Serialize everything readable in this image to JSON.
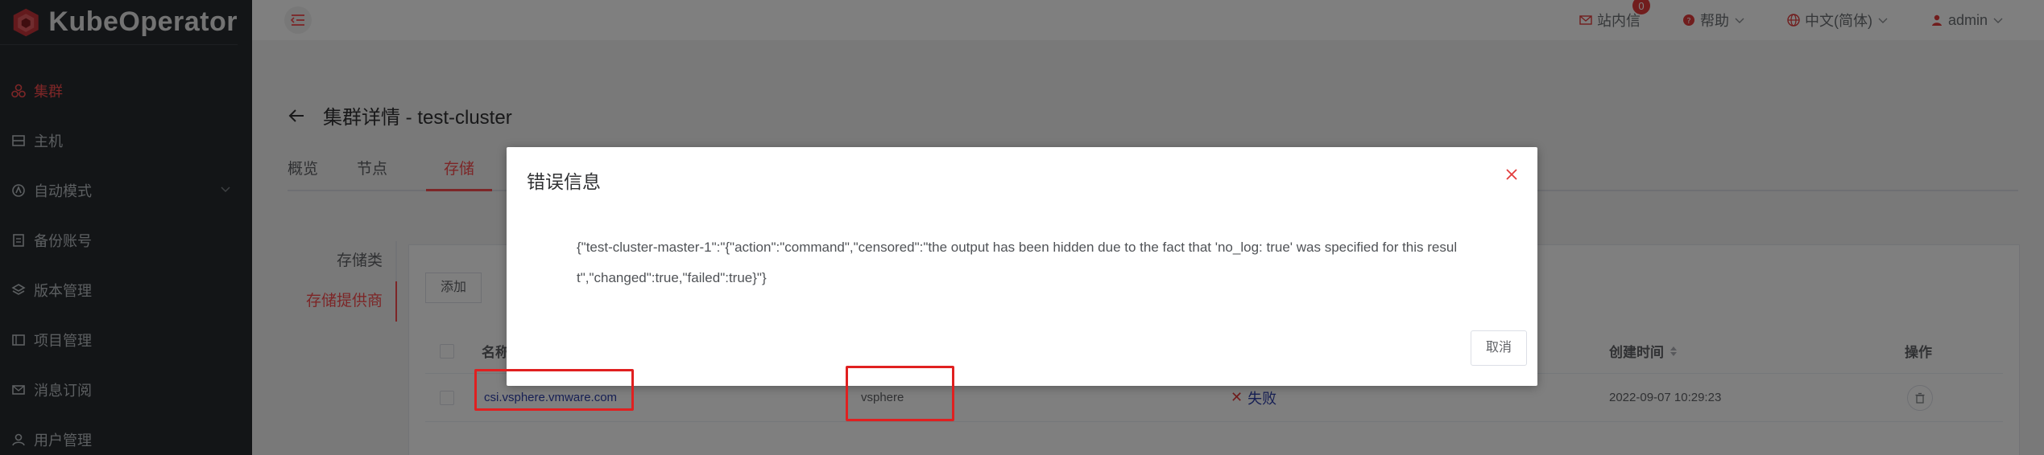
{
  "app": {
    "name": "KubeOperator"
  },
  "sidebar": {
    "items": [
      {
        "label": "集群",
        "icon": "cluster-icon",
        "active": true
      },
      {
        "label": "主机",
        "icon": "server-icon"
      },
      {
        "label": "自动模式",
        "icon": "automation-icon",
        "expandable": true
      },
      {
        "label": "备份账号",
        "icon": "backup-icon"
      },
      {
        "label": "版本管理",
        "icon": "version-icon"
      },
      {
        "label": "项目管理",
        "icon": "project-icon"
      },
      {
        "label": "消息订阅",
        "icon": "message-icon"
      },
      {
        "label": "用户管理",
        "icon": "user-icon"
      }
    ]
  },
  "header": {
    "inbox_label": "站内信",
    "inbox_count": "0",
    "help_label": "帮助",
    "language_label": "中文(简体)",
    "user_label": "admin"
  },
  "page": {
    "title": "集群详情 - test-cluster",
    "tabs": [
      "概览",
      "节点",
      "存储"
    ],
    "active_tab": "存储",
    "side_tabs": [
      "存储类",
      "存储提供商"
    ],
    "active_side_tab": "存储提供商",
    "buttons": {
      "add": "添加"
    },
    "table": {
      "headers": {
        "name": "名称",
        "created": "创建时间",
        "ops": "操作"
      },
      "rows": [
        {
          "name": "csi.vsphere.vmware.com",
          "type": "vsphere",
          "status": "失败",
          "created": "2022-09-07 10:29:23"
        }
      ]
    }
  },
  "dialog": {
    "title": "错误信息",
    "message": "{\"test-cluster-master-1\":\"{\"action\":\"command\",\"censored\":\"the output has been hidden due to the fact that 'no_log: true' was specified for this result\",\"changed\":true,\"failed\":true}\"}",
    "cancel_label": "取消"
  },
  "colors": {
    "accent": "#fa4d4f",
    "sidebar_bg": "#272b2f",
    "link": "#2d3ea8",
    "annotation": "#e02020"
  }
}
